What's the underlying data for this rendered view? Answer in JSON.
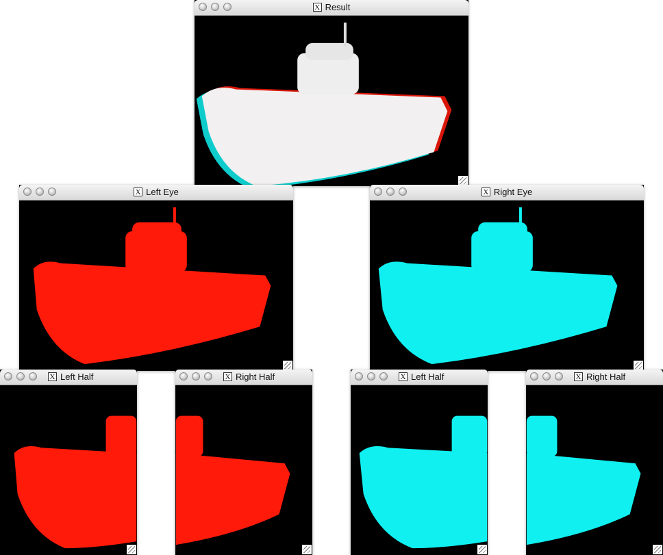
{
  "windows": {
    "result": {
      "title": "Result",
      "close_glyph": "X"
    },
    "left_eye": {
      "title": "Left Eye",
      "close_glyph": "X"
    },
    "right_eye": {
      "title": "Right Eye",
      "close_glyph": "X"
    },
    "left_half_1": {
      "title": "Left Half",
      "close_glyph": "X"
    },
    "right_half_1": {
      "title": "Right Half",
      "close_glyph": "X"
    },
    "left_half_2": {
      "title": "Left Half",
      "close_glyph": "X"
    },
    "right_half_2": {
      "title": "Right Half",
      "close_glyph": "X"
    }
  },
  "colors": {
    "left_eye": "#ff1a0a",
    "right_eye": "#10f0f0",
    "result_hull": "#f2f0f0",
    "window_bg": "#000000"
  },
  "icons": {
    "traffic_lights": "circle",
    "close_box": "x-icon",
    "resize": "resize-grip-icon"
  }
}
